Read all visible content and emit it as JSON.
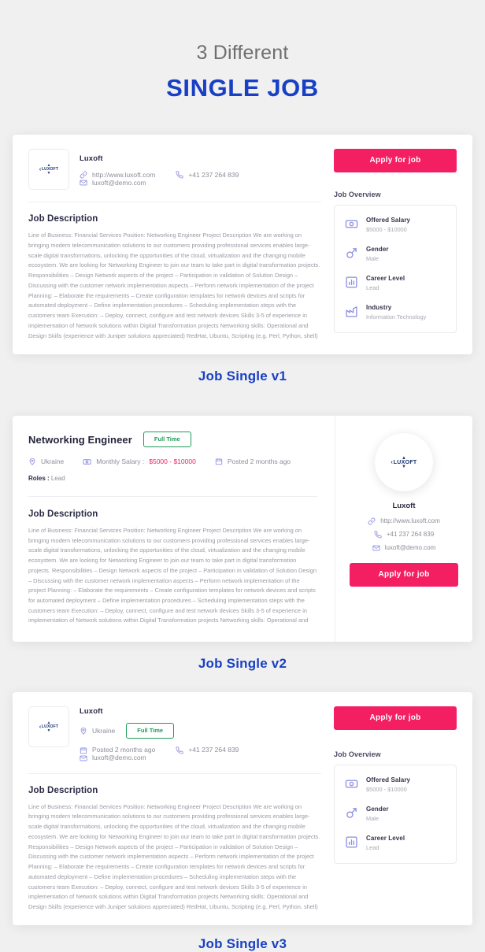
{
  "heading": {
    "subtitle": "3 Different",
    "title": "SINGLE JOB"
  },
  "colors": {
    "accent_pink": "#f41f63",
    "brand_blue": "#1940c4",
    "badge_green": "#1f9c5a",
    "icon_purple": "#8b8ce0",
    "page_bg": "#f0f0f0"
  },
  "company": {
    "name": "Luxoft",
    "logo_text": "LUXOFT",
    "website": "http://www.luxoft.com",
    "phone": "+41 237 264 839",
    "email": "luxoft@demo.com"
  },
  "job": {
    "title": "Networking Engineer",
    "type": "Full Time",
    "location": "Ukraine",
    "salary_label": "Monthly Salary :",
    "salary_value": "$5000 - $10000",
    "posted": "Posted 2 months ago",
    "roles_label": "Roles :",
    "roles_value": "Lead"
  },
  "apply_button": "Apply for job",
  "description": {
    "title": "Job Description",
    "full": "Line of Business: Financial Services Position: Networking Engineer Project Description We are working on bringing modern telecommunication solutions to our customers providing professional services enables large-scale digital transformations, unlocking the opportunities of the cloud, virtualization and the changing mobile ecosystem. We are looking for Networking Engineer to join our team to take part in digital transformation projects. Responsibilities – Design Network aspects of the project – Participation in validation of Solution Design – Discussing with the customer network implementation aspects – Perform network implementation of the project Planning: – Elaborate the requirements – Create configuration templates for network devices and scripts for automated deployment – Define implementation procedures – Scheduling implementation steps with the customers team Execution: – Deploy, connect, configure and test network devices Skills 3-5 of experience in implementation of Network solutions within Digital Transformation projects Networking skills: Operational and Design Skills (experience with Juniper solutions appreciated) RedHat, Ubuntu, Scripting (e.g. Perl, Python, shell)",
    "truncated": "Line of Business: Financial Services Position: Networking Engineer Project Description We are working on bringing modern telecommunication solutions to our customers providing professional services enables large-scale digital transformations, unlocking the opportunities of the cloud, virtualization and the changing mobile ecosystem. We are looking for Networking Engineer to join our team to take part in digital transformation projects. Responsibilities – Design Network aspects of the project – Participation in validation of Solution Design – Discussing with the customer network implementation aspects – Perform network implementation of the project Planning: – Elaborate the requirements – Create configuration templates for network devices and scripts for automated deployment – Define implementation procedures – Scheduling implementation steps with the customers team Execution: – Deploy, connect, configure and test network devices Skills 3-5 of experience in implementation of Network solutions within Digital Transformation projects Networking skills: Operational and"
  },
  "overview": {
    "title": "Job Overview",
    "items": [
      {
        "icon": "salary-icon",
        "label": "Offered Salary",
        "value": "$5000 - $10000"
      },
      {
        "icon": "gender-icon",
        "label": "Gender",
        "value": "Male"
      },
      {
        "icon": "career-level-icon",
        "label": "Career Level",
        "value": "Lead"
      },
      {
        "icon": "industry-icon",
        "label": "Industry",
        "value": "Information Technology"
      }
    ]
  },
  "captions": {
    "v1": "Job Single v1",
    "v2": "Job Single v2",
    "v3": "Job Single v3"
  }
}
